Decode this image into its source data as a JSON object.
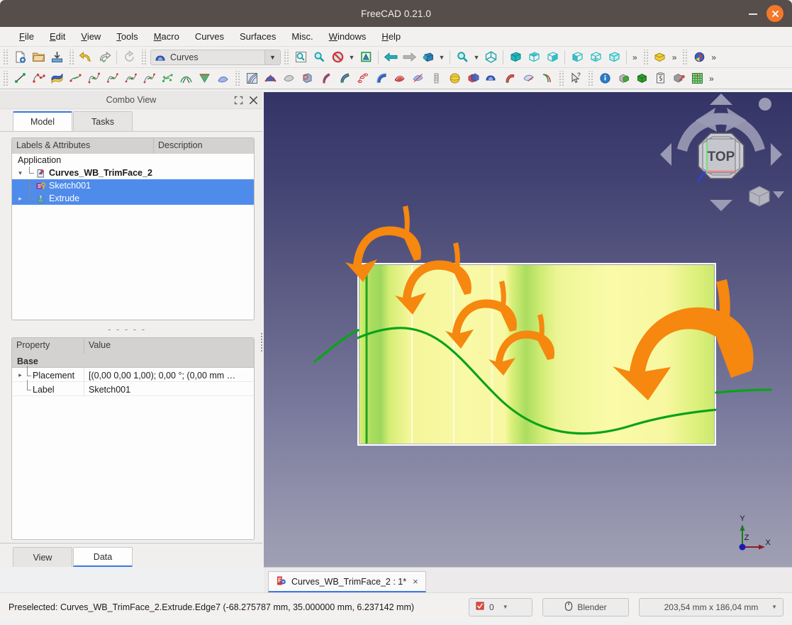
{
  "window": {
    "title": "FreeCAD 0.21.0",
    "minimize_label": "Minimize",
    "close_label": "Close"
  },
  "menubar": {
    "items": [
      {
        "label": "File",
        "mnemonic": "F"
      },
      {
        "label": "Edit",
        "mnemonic": "E"
      },
      {
        "label": "View",
        "mnemonic": "V"
      },
      {
        "label": "Tools",
        "mnemonic": "T"
      },
      {
        "label": "Macro",
        "mnemonic": "M"
      },
      {
        "label": "Curves",
        "mnemonic": ""
      },
      {
        "label": "Surfaces",
        "mnemonic": ""
      },
      {
        "label": "Misc.",
        "mnemonic": ""
      },
      {
        "label": "Windows",
        "mnemonic": "W"
      },
      {
        "label": "Help",
        "mnemonic": "H"
      }
    ]
  },
  "toolbar": {
    "workbench_selected": "Curves",
    "file_group": [
      "new-document-icon",
      "open-document-icon",
      "save-document-icon"
    ],
    "edit_group": [
      "undo-icon",
      "redo-icon",
      "refresh-icon"
    ],
    "view_group": [
      "fit-all-icon",
      "fit-selection-icon",
      "draw-style-icon",
      "bounding-box-icon"
    ],
    "nav_group": [
      "back-arrow-icon",
      "forward-arrow-icon",
      "axonometric-view-icon"
    ],
    "std_views_group": [
      "zoom-icon",
      "isometric-view-icon",
      "front-view-icon",
      "top-view-icon",
      "right-view-icon",
      "rear-view-icon",
      "bottom-view-icon",
      "left-view-icon"
    ],
    "overflow_label": "»"
  },
  "combo_view": {
    "title": "Combo View",
    "maximize_icon": "expand-icon",
    "close_icon": "close-icon",
    "tabs": [
      {
        "label": "Model",
        "active": true
      },
      {
        "label": "Tasks",
        "active": false
      }
    ],
    "tree": {
      "headers": [
        "Labels & Attributes",
        "Description"
      ],
      "nodes": [
        {
          "label": "Application",
          "depth": 0,
          "bold": false,
          "selected": false,
          "expander": "",
          "icon": ""
        },
        {
          "label": "Curves_WB_TrimFace_2",
          "depth": 1,
          "bold": true,
          "selected": false,
          "expander": "v",
          "icon": "document-icon"
        },
        {
          "label": "Sketch001",
          "depth": 2,
          "bold": false,
          "selected": true,
          "expander": "",
          "icon": "sketch-icon"
        },
        {
          "label": "Extrude",
          "depth": 2,
          "bold": false,
          "selected": true,
          "expander": ">",
          "icon": "extrude-icon"
        }
      ]
    },
    "separator": "- - - - -",
    "properties": {
      "headers": [
        "Property",
        "Value"
      ],
      "group_label": "Base",
      "rows": [
        {
          "name": "Placement",
          "value": "[(0,00 0,00 1,00); 0,00 °; (0,00 mm  …",
          "expandable": true
        },
        {
          "name": "Label",
          "value": "Sketch001",
          "expandable": false
        }
      ]
    },
    "bottom_tabs": [
      {
        "label": "View",
        "active": false
      },
      {
        "label": "Data",
        "active": true
      }
    ]
  },
  "viewport": {
    "nav_cube_face": "TOP",
    "axis_labels": {
      "x": "X",
      "y": "Y",
      "z": "Z"
    },
    "colors": {
      "background_top": "#333366",
      "background_bottom": "#a0a0b4",
      "surface_yellow": "#f7f79a",
      "surface_green": "#a8dc5e",
      "edge_green": "#1ba01b",
      "arrow_orange": "#f58410"
    }
  },
  "document_tabs": [
    {
      "label": "Curves_WB_TrimFace_2 : 1*",
      "icon": "freecad-document-icon",
      "close": "×",
      "active": true
    }
  ],
  "statusbar": {
    "message": "Preselected: Curves_WB_TrimFace_2.Extrude.Edge7 (-68.275787 mm, 35.000000 mm, 6.237142 mm)",
    "selection_count": "0",
    "navigation_style": "Blender",
    "dimensions": "203,54 mm x 186,04 mm"
  }
}
